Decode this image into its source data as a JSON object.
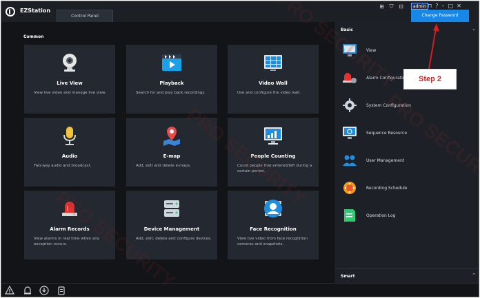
{
  "app": {
    "name": "EZStation",
    "tab": "Control Panel"
  },
  "topbar": {
    "user": "admin",
    "change_password": "Change Password"
  },
  "main": {
    "section": "Common",
    "cards": [
      {
        "title": "Live View",
        "desc": "View live video and manage live view.",
        "icon": "camera-icon"
      },
      {
        "title": "Playback",
        "desc": "Search for and play back recordings.",
        "icon": "playback-icon"
      },
      {
        "title": "Video Wall",
        "desc": "Use and configure the video wall.",
        "icon": "video-wall-icon"
      },
      {
        "title": "Audio",
        "desc": "Two-way audio and broadcast.",
        "icon": "microphone-icon"
      },
      {
        "title": "E-map",
        "desc": "Add, edit and delete e-maps.",
        "icon": "map-pin-icon"
      },
      {
        "title": "People Counting",
        "desc": "Count people that entered/left during a certain period.",
        "icon": "chart-monitor-icon"
      },
      {
        "title": "Alarm Records",
        "desc": "View alarms in real time when any exception occurs.",
        "icon": "alarm-light-icon"
      },
      {
        "title": "Device Management",
        "desc": "Add, edit, delete and configure devices.",
        "icon": "server-icon"
      },
      {
        "title": "Face Recognition",
        "desc": "View live video from face recognition cameras and snapshots.",
        "icon": "face-recognition-icon"
      }
    ]
  },
  "sidebar": {
    "section": "Basic",
    "items": [
      {
        "label": "View",
        "icon": "monitor-icon"
      },
      {
        "label": "Alarm Configuration",
        "icon": "alarm-config-icon"
      },
      {
        "label": "System Configuration",
        "icon": "gear-icon"
      },
      {
        "label": "Sequence Resource",
        "icon": "sequence-icon"
      },
      {
        "label": "User Management",
        "icon": "users-icon"
      },
      {
        "label": "Recording Schedule",
        "icon": "schedule-icon"
      },
      {
        "label": "Operation Log",
        "icon": "log-icon"
      }
    ],
    "footer": "Smart"
  },
  "annotation": {
    "label": "Step 2",
    "color": "#d81e1e"
  },
  "watermark": "PRO SECURITY"
}
